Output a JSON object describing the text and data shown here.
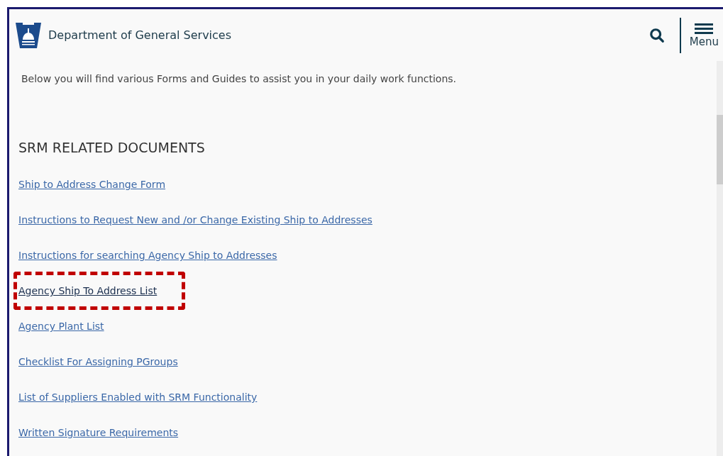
{
  "header": {
    "title": "Department of General Services",
    "menu_label": "Menu"
  },
  "intro": "Below you will find various Forms and Guides to assist you in your daily work functions.",
  "section": {
    "heading": "SRM RELATED DOCUMENTS"
  },
  "links": [
    {
      "label": "Ship to Address Change Form",
      "highlighted": false
    },
    {
      "label": "Instructions to Request New and /or Change Existing Ship to Addresses",
      "highlighted": false
    },
    {
      "label": "Instructions for searching Agency Ship to Addresses",
      "highlighted": false
    },
    {
      "label": "Agency Ship To Address List",
      "highlighted": true
    },
    {
      "label": "Agency Plant List",
      "highlighted": false
    },
    {
      "label": "Checklist For Assigning PGroups",
      "highlighted": false
    },
    {
      "label": "List of Suppliers Enabled with SRM Functionality",
      "highlighted": false
    },
    {
      "label": "Written Signature Requirements",
      "highlighted": false
    }
  ]
}
